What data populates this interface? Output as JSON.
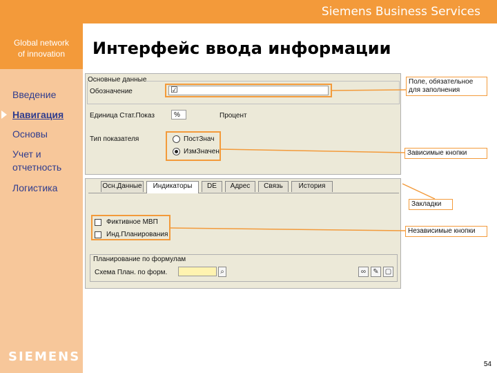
{
  "header": {
    "brand": "Siemens Business Services"
  },
  "sidebar": {
    "tagline_1": "Global network",
    "tagline_2": "of innovation",
    "items": [
      {
        "label": "Введение"
      },
      {
        "label": "Навигация",
        "active": true
      },
      {
        "label": "Основы"
      },
      {
        "label": "Учет и"
      },
      {
        "label": "отчетность"
      },
      {
        "label": "Логистика"
      }
    ],
    "logo": "SIEMENS"
  },
  "page": {
    "title": "Интерфейс ввода информации",
    "number": "54"
  },
  "form": {
    "group_title": "Основные данные",
    "designation_label": "Обозначение",
    "unit_label": "Единица Стат.Показ",
    "unit_value": "%",
    "percent_label": "Процент",
    "indicator_type_label": "Тип показателя",
    "radio_1": "ПостЗнач",
    "radio_2": "ИзмЗначен",
    "tabs": [
      "Осн.Данные",
      "Индикаторы",
      "DE",
      "Адрес",
      "Связь",
      "История"
    ],
    "active_tab": "Индикаторы",
    "check_1": "Фиктивное МВП",
    "check_2": "Инд.Планирования",
    "planning_group": "Планирование по формулам",
    "formula_label": "Схема План. по форм."
  },
  "annotations": {
    "required_field": "Поле, обязательное для заполнения",
    "dependent_buttons": "Зависимые кнопки",
    "tabs": "Закладки",
    "independent_buttons": "Независимые кнопки"
  },
  "colors": {
    "accent": "#f39a3a",
    "sidebar": "#f7c79a",
    "nav_text": "#2f3c8e"
  }
}
